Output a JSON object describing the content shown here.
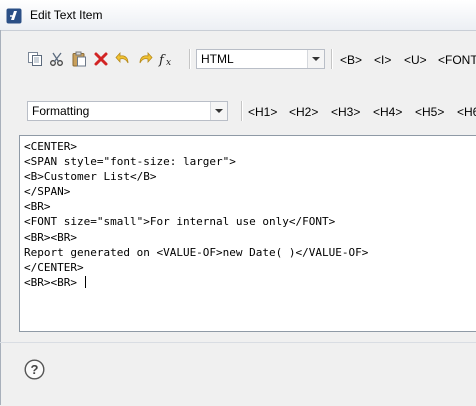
{
  "window": {
    "title": "Edit Text Item"
  },
  "toolbar": {
    "icons": [
      "copy-icon",
      "cut-icon",
      "paste-icon",
      "delete-icon",
      "undo-icon",
      "redo-icon",
      "function-icon"
    ],
    "format_value": "HTML",
    "tags_row1": [
      "<B>",
      "<I>",
      "<U>",
      "<FONT"
    ],
    "heading_value": "Formatting",
    "tags_row2": [
      "<H1>",
      "<H2>",
      "<H3>",
      "<H4>",
      "<H5>",
      "<H6"
    ]
  },
  "editor": {
    "lines": [
      "<CENTER>",
      "<SPAN style=\"font-size: larger\">",
      "<B>Customer List</B>",
      "</SPAN>",
      "<BR>",
      "<FONT size=\"small\">For internal use only</FONT>",
      "<BR><BR>",
      "Report generated on <VALUE-OF>new Date( )</VALUE-OF>",
      "</CENTER>",
      "<BR><BR> "
    ]
  },
  "footer": {
    "help_icon": "help-icon"
  },
  "colors": {
    "accent": "#1f5fa8",
    "delete": "#d22424",
    "undo": "#e8b31e"
  }
}
